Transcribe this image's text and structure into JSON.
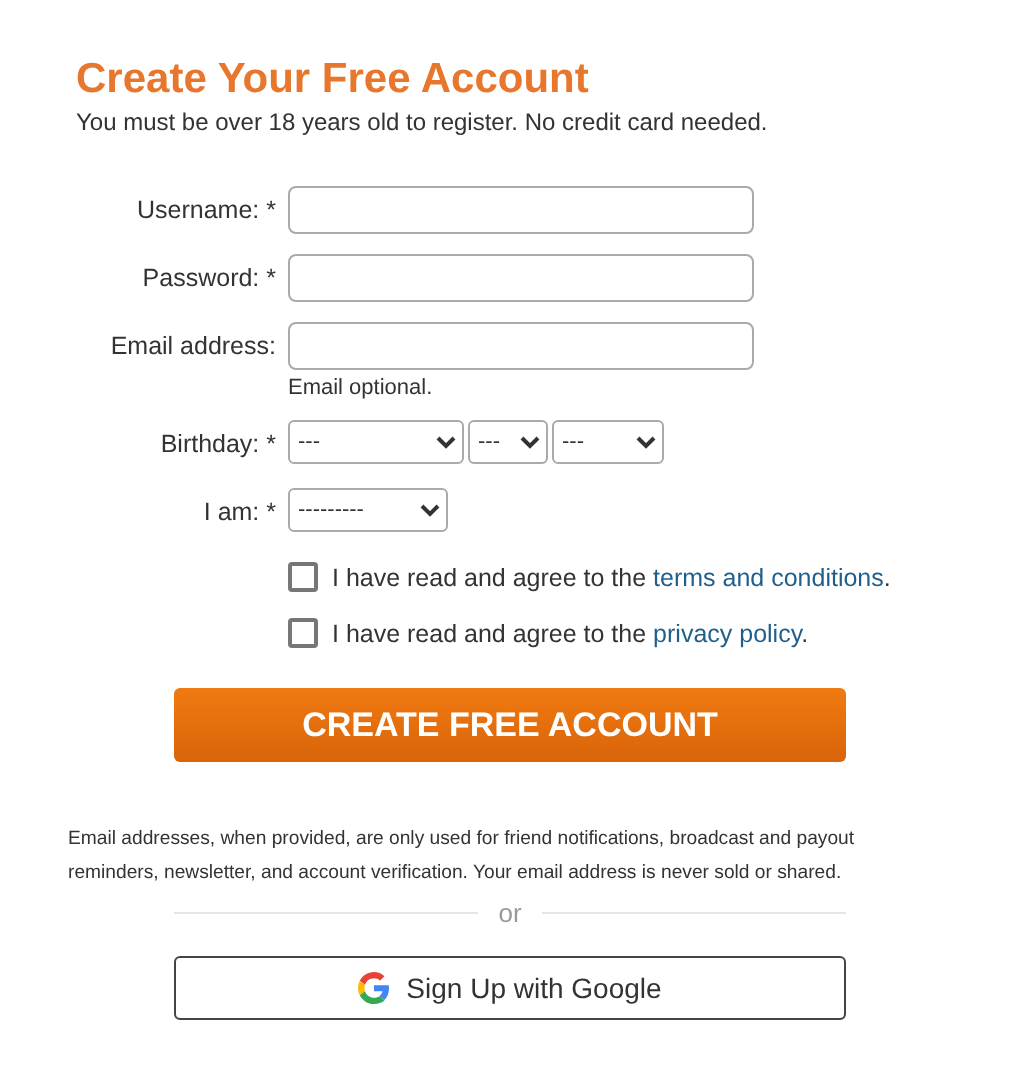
{
  "title": "Create Your Free Account",
  "subtitle": "You must be over 18 years old to register. No credit card needed.",
  "fields": [
    {
      "label": "Username: *"
    },
    {
      "label": "Password: *"
    },
    {
      "label": "Email address:",
      "hint": "Email optional."
    }
  ],
  "birthday": {
    "label": "Birthday: *",
    "selects": [
      "---",
      "---",
      "---"
    ]
  },
  "gender": {
    "label": "I am: *",
    "value": "---------"
  },
  "agreements": [
    {
      "text": "I have read and agree to the ",
      "link": "terms and conditions",
      "suffix": ".",
      "checked": false
    },
    {
      "text": "I have read and agree to the ",
      "link": "privacy policy",
      "suffix": ".",
      "checked": false
    }
  ],
  "submit": "CREATE FREE ACCOUNT",
  "notice": "Email addresses, when provided, are only used for friend notifications, broadcast and payout reminders, newsletter, and account verification. Your email address is never sold or shared.",
  "divider": "or",
  "google_button": "Sign Up with Google"
}
